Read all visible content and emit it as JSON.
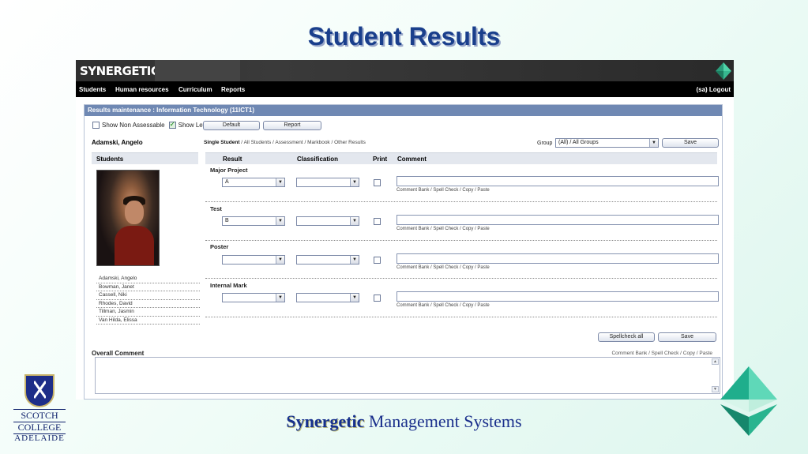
{
  "slide": {
    "title": "Student Results",
    "footer_brand": "Synergetic",
    "footer_rest": " Management Systems",
    "school": [
      "SCOTCH",
      "COLLEGE",
      "ADELAIDE"
    ]
  },
  "app": {
    "brand": "SYNERGETIC",
    "nav": [
      "Students",
      "Human resources",
      "Curriculum",
      "Reports"
    ],
    "logout": "(sa) Logout"
  },
  "panel": {
    "title": "Results maintenance : Information Technology (11ICT1)",
    "show_non_assessable": "Show Non Assessable",
    "show_left": "Show Left",
    "show_non_assessable_checked": false,
    "show_left_checked": true,
    "default_btn": "Default",
    "report_btn": "Report",
    "student_name": "Adamski, Angelo",
    "links": {
      "single": "Single Student",
      "all": "All Students",
      "assessment": "Assessment",
      "markbook": "Markbook",
      "other": "Other Results"
    },
    "group_label": "Group",
    "group_value": "(All) / All Groups",
    "save_btn": "Save"
  },
  "students": {
    "header": "Students",
    "list": [
      "Adamski, Angelo",
      "Bowman, Janet",
      "Cassell, Niki",
      "Rhodes, David",
      "Tillman, Jasmin",
      "Van Hilda, Elissa"
    ]
  },
  "grid": {
    "columns": [
      "Result",
      "Classification",
      "Print",
      "Comment"
    ],
    "tools": "Comment Bank / Spell Check / Copy / Paste",
    "rows": [
      {
        "label": "Major Project",
        "result": "A",
        "classification": ""
      },
      {
        "label": "Test",
        "result": "B",
        "classification": ""
      },
      {
        "label": "Poster",
        "result": "",
        "classification": ""
      },
      {
        "label": "Internal Mark",
        "result": "",
        "classification": ""
      }
    ],
    "spellcheck_btn": "Spellcheck all",
    "save_btn": "Save"
  },
  "overall": {
    "label": "Overall Comment",
    "tools": "Comment Bank  /  Spell Check  /  Copy  /  Paste"
  },
  "icons": {
    "brand_diamond": "diamond-logo-icon",
    "dropdown": "chevron-down-icon",
    "footer_gem": "gem-logo-icon",
    "crest": "school-crest-icon"
  },
  "colors": {
    "title": "#1a3f8c",
    "panel_head": "#6f88b3",
    "gem": "#1fae8c"
  }
}
